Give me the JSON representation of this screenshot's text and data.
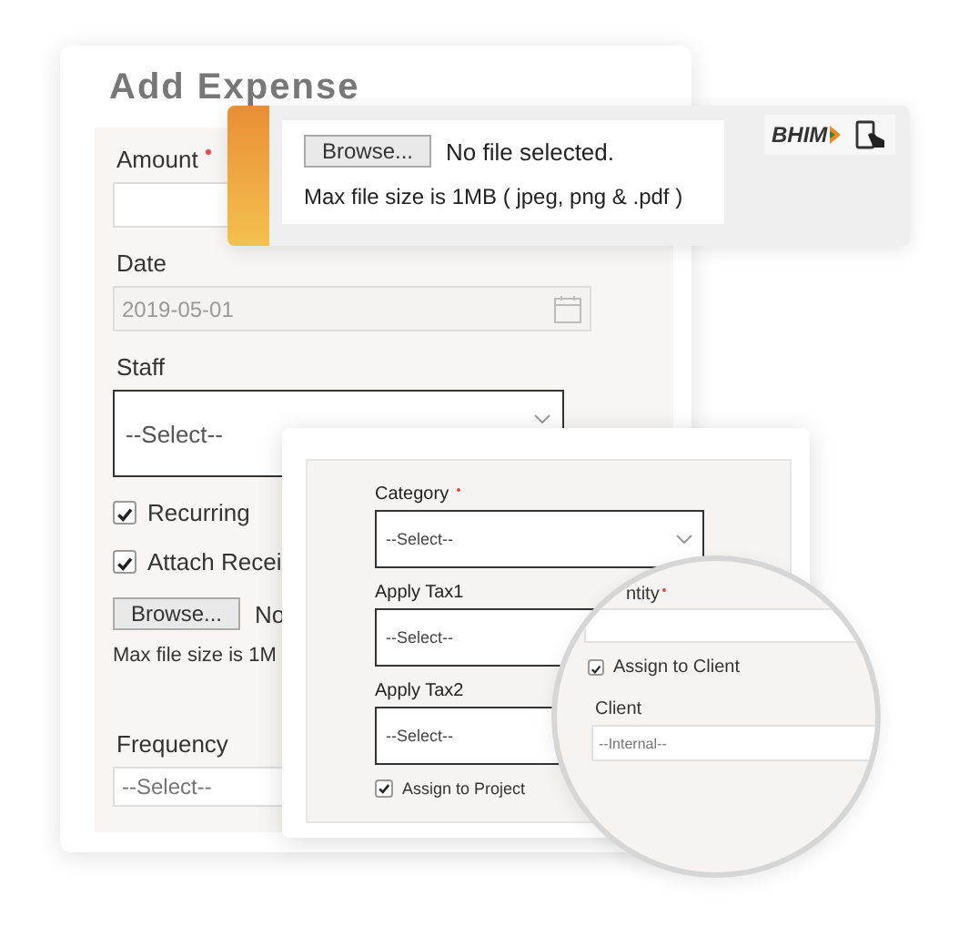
{
  "add_expense": {
    "title": "Add Expense",
    "fields": [
      {
        "kind": "input",
        "label": "Amount",
        "required": true
      },
      {
        "kind": "date",
        "label": "Date",
        "value": "2019-05-01"
      },
      {
        "kind": "select",
        "label": "Staff",
        "value": "--Select--"
      }
    ],
    "checkboxes": [
      {
        "label": "Recurring",
        "checked": true
      },
      {
        "label": "Attach Recei",
        "checked": true
      }
    ],
    "upload": {
      "button": "Browse...",
      "status": "No",
      "hint": "Max file size is 1M"
    },
    "frequency": {
      "label": "Frequency",
      "placeholder": "--Select--"
    }
  },
  "upload_popover": {
    "button": "Browse...",
    "status": "No file selected.",
    "hint": "Max file size is 1MB ( jpeg, png & .pdf )",
    "brand": "BHIM"
  },
  "category_card": {
    "fields": [
      {
        "label": "Category",
        "required": true,
        "value": "--Select--"
      },
      {
        "label": "Apply Tax1",
        "required": false,
        "value": "--Select--"
      },
      {
        "label": "Apply Tax2",
        "required": false,
        "value": "--Select--"
      }
    ],
    "checkbox": {
      "label": "Assign to Project",
      "checked": true
    }
  },
  "magnifier": {
    "field_label": "ntity",
    "required": true,
    "checkbox": {
      "label": "Assign to Client",
      "checked": true
    },
    "client": {
      "label": "Client",
      "placeholder": "--Internal--"
    }
  }
}
